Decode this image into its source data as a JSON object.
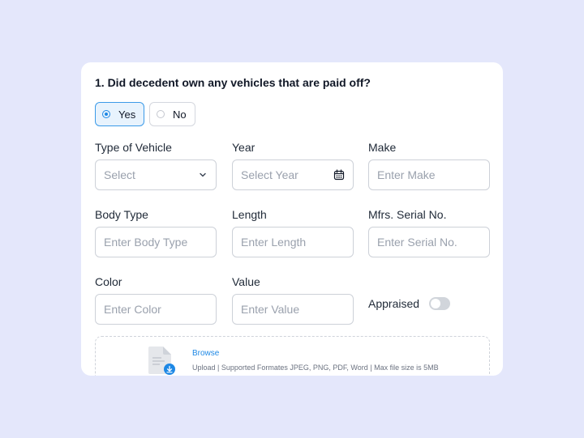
{
  "question": "1. Did decedent own any vehicles that are paid off?",
  "options": {
    "yes": "Yes",
    "no": "No",
    "selected": "Yes"
  },
  "fields": {
    "type_of_vehicle": {
      "label": "Type of Vehicle",
      "placeholder": "Select"
    },
    "year": {
      "label": "Year",
      "placeholder": "Select Year"
    },
    "make": {
      "label": "Make",
      "placeholder": "Enter Make"
    },
    "body_type": {
      "label": "Body Type",
      "placeholder": "Enter Body Type"
    },
    "length": {
      "label": "Length",
      "placeholder": "Enter Length"
    },
    "serial": {
      "label": "Mfrs. Serial No.",
      "placeholder": "Enter Serial No."
    },
    "color": {
      "label": "Color",
      "placeholder": "Enter Color"
    },
    "value": {
      "label": "Value",
      "placeholder": "Enter Value"
    }
  },
  "appraised": {
    "label": "Appraised",
    "on": false
  },
  "upload": {
    "browse": "Browse",
    "hint": "Upload | Supported Formates JPEG, PNG, PDF, Word | Max file size is 5MB"
  },
  "icons": {
    "dropdown": "chevron-down-icon",
    "calendar": "calendar-icon",
    "file": "document-upload-icon"
  },
  "colors": {
    "accent": "#1e88e5",
    "background": "#e4e7fb",
    "selected_bg": "#e8f3fd"
  }
}
